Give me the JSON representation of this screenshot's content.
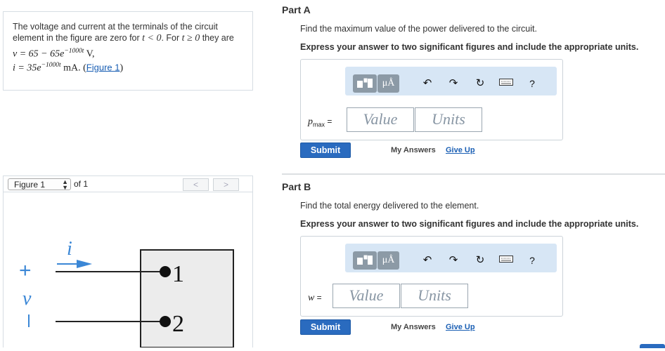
{
  "problem": {
    "text_before": "The voltage and current at the terminals of the circuit element in the figure are zero for ",
    "cond1": "t < 0",
    "text_mid": ". For ",
    "cond2": "t ≥ 0",
    "text_after": " they are",
    "v_prefix": "v = 65  −  65e",
    "v_exp": "−1000t",
    "v_unit": " V,",
    "i_prefix": "i = 35e",
    "i_exp": "−1000t",
    "i_unit": " mA. (",
    "figure_link": "Figure 1",
    "close_paren": ")"
  },
  "figure_nav": {
    "selected": "Figure 1",
    "of_text": "of 1",
    "prev": "<",
    "next": ">"
  },
  "figure": {
    "current_label": "i",
    "voltage_label": "v",
    "plus": "+",
    "minus": "−",
    "terminal1": "1",
    "terminal2": "2"
  },
  "partA": {
    "title": "Part A",
    "question": "Find the maximum value of the power delivered to the circuit.",
    "instruction": "Express your answer to two significant figures and include the appropriate units.",
    "var_main": "p",
    "var_sub": "max",
    "equals": " =",
    "value_placeholder": "Value",
    "units_placeholder": "Units",
    "submit": "Submit",
    "my_answers": "My Answers",
    "give_up": "Give Up"
  },
  "partB": {
    "title": "Part B",
    "question": "Find the total energy delivered to the element.",
    "instruction": "Express your answer to two significant figures and include the appropriate units.",
    "var_main": "w",
    "equals": " =",
    "value_placeholder": "Value",
    "units_placeholder": "Units",
    "submit": "Submit",
    "my_answers": "My Answers",
    "give_up": "Give Up"
  },
  "toolbar": {
    "mu_label": "μÅ",
    "help": "?",
    "icons": [
      "templates-icon",
      "units-icon",
      "undo-icon",
      "redo-icon",
      "reset-icon",
      "keyboard-icon",
      "help-icon"
    ]
  },
  "colors": {
    "link": "#1a5fb4",
    "submit_bg": "#2a6bbf",
    "toolbar_bg": "#d7e6f5",
    "tool_btn_bg": "#8c9aa6",
    "figure_accent": "#3b87d6"
  }
}
